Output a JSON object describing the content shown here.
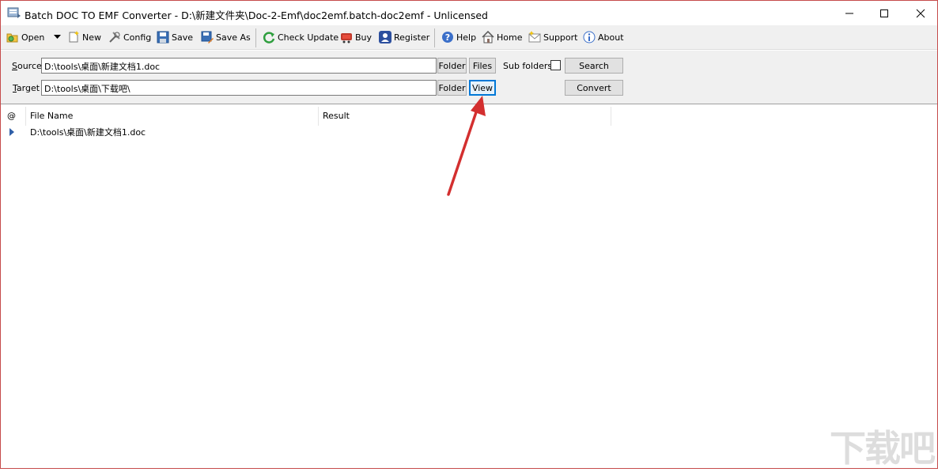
{
  "window": {
    "title": "Batch DOC TO EMF Converter - D:\\新建文件夹\\Doc-2-Emf\\doc2emf.batch-doc2emf - Unlicensed",
    "border_color": "#c64b4b"
  },
  "toolbar": {
    "open": "Open",
    "new": "New",
    "config": "Config",
    "save": "Save",
    "save_as": "Save As",
    "check_update": "Check Update",
    "buy": "Buy",
    "register": "Register",
    "help": "Help",
    "home": "Home",
    "support": "Support",
    "about": "About"
  },
  "paths": {
    "source_label_key": "S",
    "source_label_rest": "ource",
    "source_value": "D:\\tools\\桌面\\新建文档1.doc",
    "target_label_key": "T",
    "target_label_rest": "arget",
    "target_value": "D:\\tools\\桌面\\下载吧\\",
    "folder": "Folder",
    "files": "Files",
    "view": "View",
    "subfolders": "Sub folders",
    "search": "Search",
    "convert": "Convert"
  },
  "list": {
    "columns": [
      "@",
      "File Name",
      "Result"
    ],
    "rows": [
      {
        "file": "D:\\tools\\桌面\\新建文档1.doc",
        "result": ""
      }
    ]
  },
  "annotation": {
    "arrow_color": "#d32f2f"
  },
  "watermark": "下载吧"
}
